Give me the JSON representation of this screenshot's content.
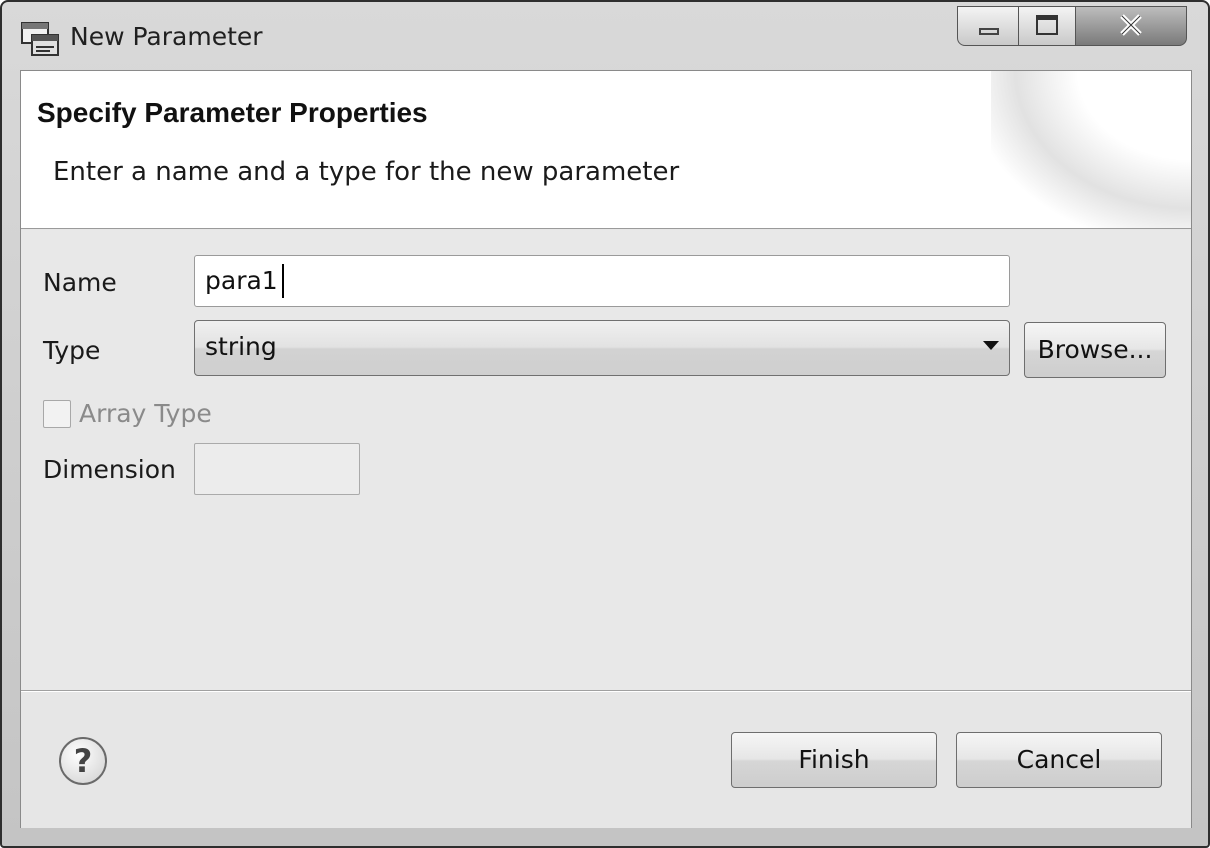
{
  "window": {
    "title": "New Parameter",
    "icon": "parameter-wizard-icon",
    "controls": [
      "minimize-icon",
      "maximize-icon",
      "close-icon"
    ]
  },
  "banner": {
    "title": "Specify Parameter Properties",
    "subtitle": "Enter a name and a type for the new parameter"
  },
  "form": {
    "name_label": "Name",
    "name_value": "para1",
    "type_label": "Type",
    "type_value": "string",
    "browse_label": "Browse...",
    "array_type_label": "Array Type",
    "array_type_checked": false,
    "dimension_label": "Dimension",
    "dimension_value": ""
  },
  "footer": {
    "help_icon": "?",
    "finish_label": "Finish",
    "cancel_label": "Cancel"
  }
}
